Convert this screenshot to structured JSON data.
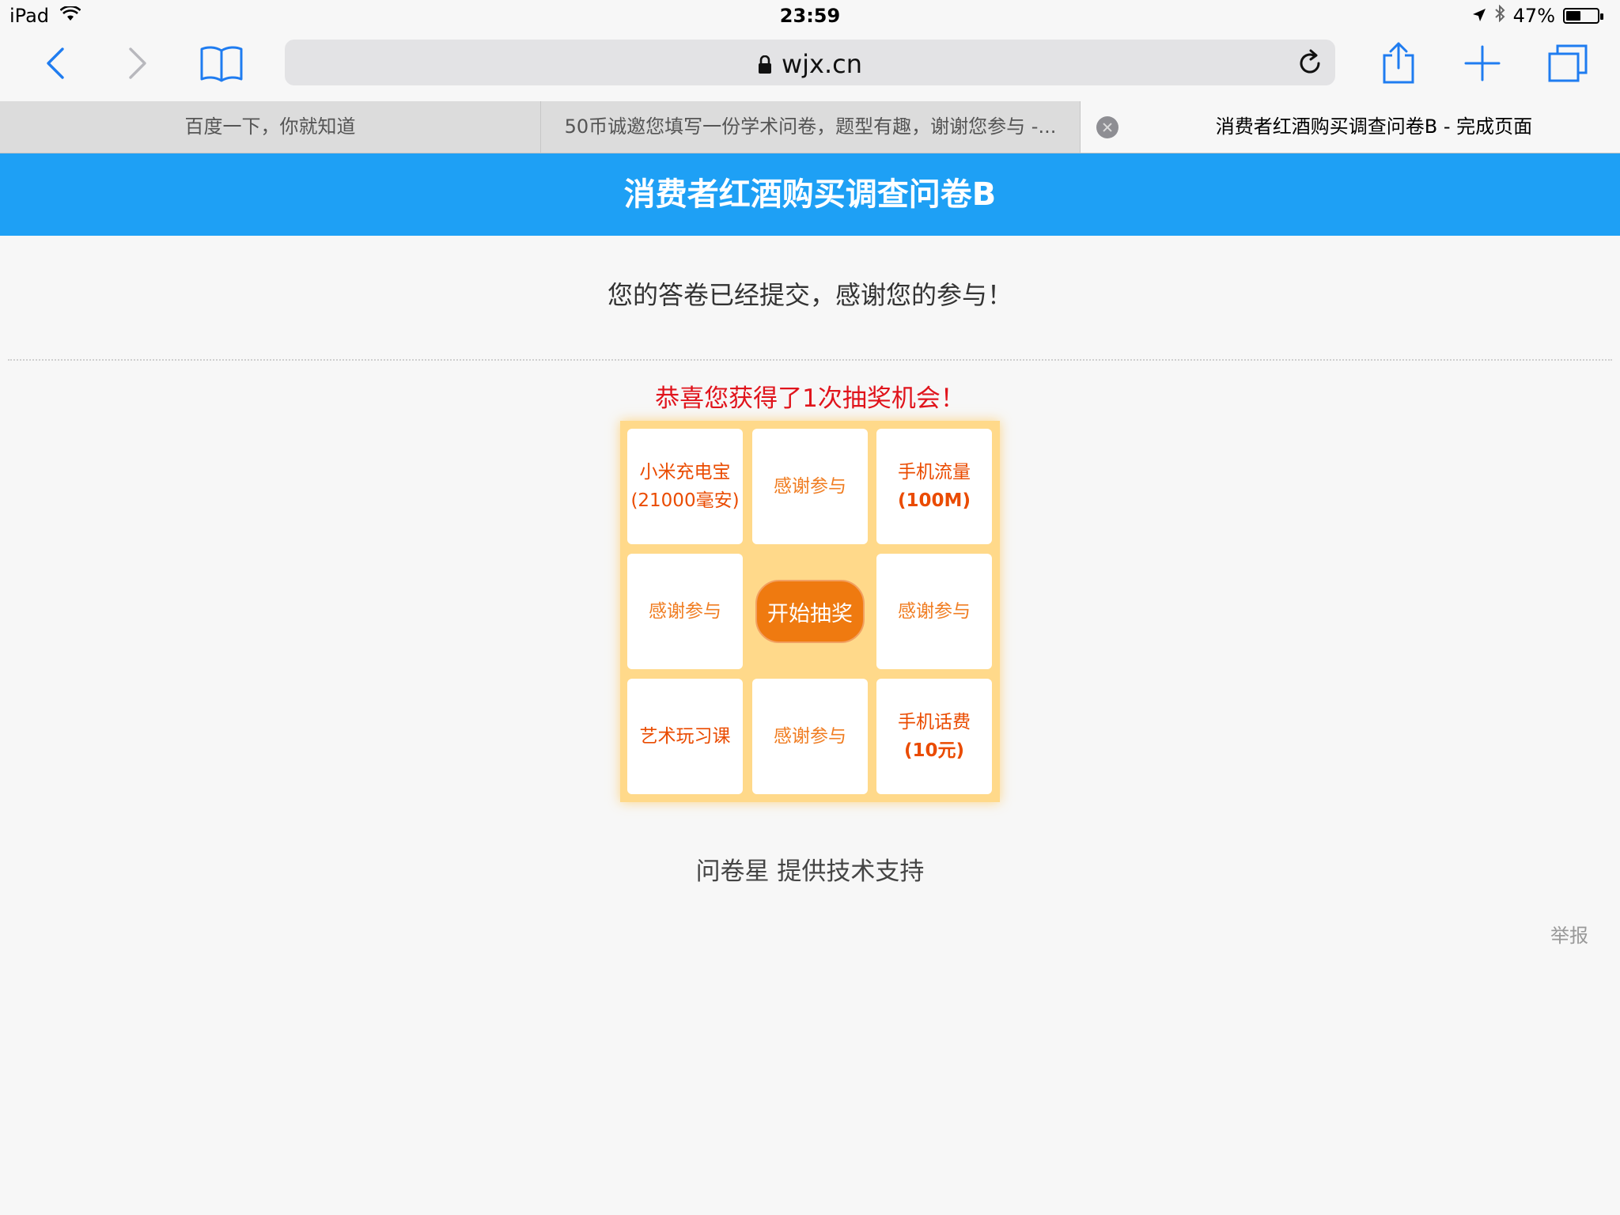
{
  "status_bar": {
    "device": "iPad",
    "time": "23:59",
    "battery_text": "47%",
    "battery_level": 0.47,
    "icons": [
      "wifi-icon",
      "location-icon",
      "bluetooth-icon",
      "battery-icon"
    ]
  },
  "toolbar": {
    "url": "wjx.cn",
    "icons": [
      "back-icon",
      "forward-icon",
      "bookmarks-icon",
      "lock-icon",
      "reload-icon",
      "share-icon",
      "new-tab-icon",
      "tabs-icon"
    ],
    "accent_color": "#1f7cf0"
  },
  "tabs": [
    {
      "title": "百度一下，你就知道",
      "active": false
    },
    {
      "title": "50币诚邀您填写一份学术问卷，题型有趣，谢谢您参与 -...",
      "active": false
    },
    {
      "title": "消费者红酒购买调查问卷B - 完成页面",
      "active": true
    }
  ],
  "page": {
    "header_title": "消费者红酒购买调查问卷B",
    "header_color": "#1ea0f5",
    "thanks_text": "您的答卷已经提交，感谢您的参与！",
    "congrats_text": "恭喜您获得了1次抽奖机会！",
    "lottery": {
      "cells": [
        {
          "line1": "小米充电宝",
          "line2": "(21000毫安)"
        },
        {
          "line1": "感谢参与",
          "line2": ""
        },
        {
          "line1": "手机流量",
          "line2": "(100M)"
        },
        {
          "line1": "感谢参与",
          "line2": ""
        },
        {
          "line1": "感谢参与",
          "line2": ""
        },
        {
          "line1": "艺术玩习课",
          "line2": ""
        },
        {
          "line1": "感谢参与",
          "line2": ""
        },
        {
          "line1": "手机话费",
          "line2": "(10元)"
        }
      ],
      "start_button": "开始抽奖"
    },
    "support_text": "问卷星 提供技术支持",
    "report_link": "举报"
  }
}
